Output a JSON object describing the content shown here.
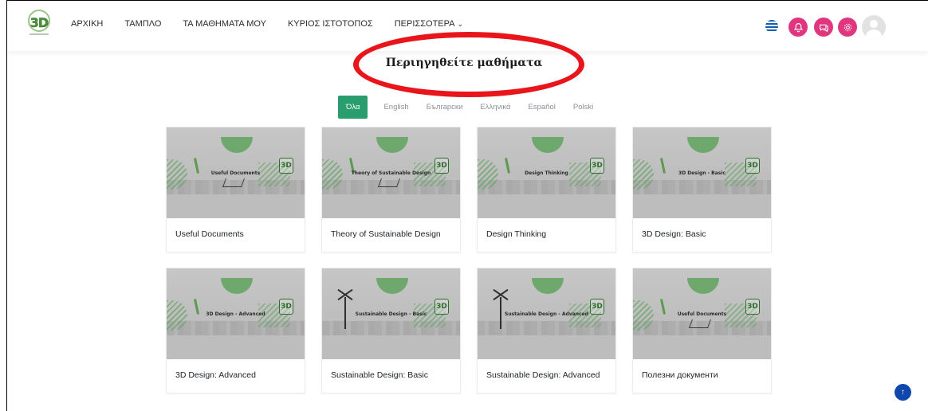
{
  "nav": {
    "items": [
      {
        "label": "ΑΡΧΙΚΗ"
      },
      {
        "label": "ΤΑΜΠΛΟ"
      },
      {
        "label": "ΤΑ ΜΑΘΗΜΑΤΑ ΜΟΥ"
      },
      {
        "label": "ΚΥΡΙΟΣ ΙΣΤΟΤΟΠΟΣ"
      },
      {
        "label": "ΠΕΡΙΣΣΟΤΕΡΑ"
      }
    ],
    "more_chevron": "⌄",
    "logo_text": "3D",
    "header_icons": [
      "notifications-icon",
      "messages-icon",
      "settings-icon"
    ],
    "accent_pink": "#e0357f"
  },
  "page": {
    "title": "Περιηγηθείτε μαθήματα"
  },
  "filters": {
    "active": "Όλα",
    "options": [
      "Όλα",
      "English",
      "Български",
      "Ελληνικά",
      "Español",
      "Polski"
    ],
    "accent_color": "#2a9d6f"
  },
  "courses": [
    {
      "title": "Useful Documents",
      "image_caption": "Useful Documents"
    },
    {
      "title": "Theory of Sustainable Design",
      "image_caption": "Theory of Sustainable Design"
    },
    {
      "title": "Design Thinking",
      "image_caption": "Design Thinking"
    },
    {
      "title": "3D Design: Basic",
      "image_caption": "3D Design - Basic"
    },
    {
      "title": "3D Design: Advanced",
      "image_caption": "3D Design - Advanced"
    },
    {
      "title": "Sustainable Design: Basic",
      "image_caption": "Sustainable Design - Basic"
    },
    {
      "title": "Sustainable Design: Advanced",
      "image_caption": "Sustainable Design - Advanced"
    },
    {
      "title": "Полезни документи",
      "image_caption": "Useful Documents"
    }
  ],
  "thumb_badge": "3D",
  "scroll_top_icon": "↑"
}
